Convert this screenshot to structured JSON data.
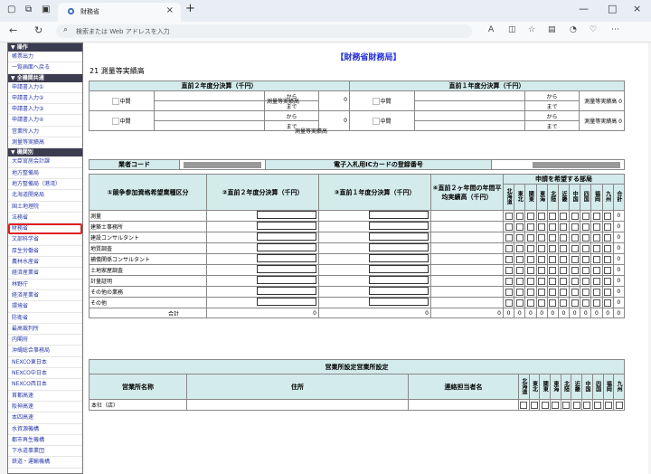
{
  "browser": {
    "tab_title": "財務省",
    "address_placeholder": "検索または Web アドレスを入力"
  },
  "sidebar": {
    "sec1": "▼ 操作",
    "sec1_items": [
      "帳票出力",
      "一覧画面へ戻る"
    ],
    "sec2": "▼ 全機関共通",
    "sec2_items": [
      "申請書入力①",
      "申請書入力②",
      "申請書入力③",
      "申請書入力④",
      "営業所入力",
      "測量等実績高"
    ],
    "sec3": "▼ 機関別",
    "sec3_items": [
      "大臣官房会計課",
      "地方整備局",
      "地方整備局（港湾）",
      "北海道開発局",
      "国土地理院",
      "法務省",
      "財務省",
      "文部科学省",
      "厚生労働省",
      "農林水産省",
      "経済産業省",
      "林野庁",
      "経済産業省",
      "環境省",
      "防衛省",
      "最高裁判所",
      "内閣府",
      "沖縄総合事務局",
      "NEXCO東日本",
      "NEXCO中日本",
      "NEXCO西日本",
      "首都高速",
      "阪神高速",
      "本四高速",
      "水資源機構",
      "都市再生機構",
      "下水道事業団",
      "鉄道・運輸機構"
    ],
    "active": "財務省"
  },
  "page": {
    "title": "【財務省財務局】",
    "section": "21 測量等実績高",
    "prev2": "直前２年度分決算（千円）",
    "prev1": "直前１年度分決算（千円）",
    "chukan": "中間",
    "kara": "から",
    "made": "まで",
    "jisseki": "測量等実績高",
    "zero": "0",
    "gyosha_code": "業者コード",
    "ic_card": "電子入札用ICカードの登録番号",
    "col1": "①競争参加資格希望業種区分",
    "col2": "②直前２年度分決算（千円）",
    "col3": "③直前１年度分決算（千円）",
    "col4": "④直前２ヶ年間の年間平均実績高（千円）",
    "col5": "申請を希望する部局",
    "bureaus": [
      "北海道",
      "東北",
      "関東",
      "東海",
      "北陸",
      "近畿",
      "中国",
      "四国",
      "福岡",
      "九州",
      "合計"
    ],
    "rows": [
      "測量",
      "建築士事務所",
      "建設コンサルタント",
      "地質調査",
      "補償関係コンサルタント",
      "土地家屋調査",
      "計量証明",
      "その他の業務",
      "その他"
    ],
    "total": "合計",
    "office_title": "営業所設定営業所設定",
    "office_name": "営業所名称",
    "address": "住所",
    "contact": "連絡担当者名",
    "office_bureaus": [
      "北海道",
      "東北",
      "関東",
      "東海",
      "北陸",
      "近畿",
      "中国",
      "四国",
      "福岡",
      "九州"
    ],
    "office_row": "本社（店）"
  }
}
